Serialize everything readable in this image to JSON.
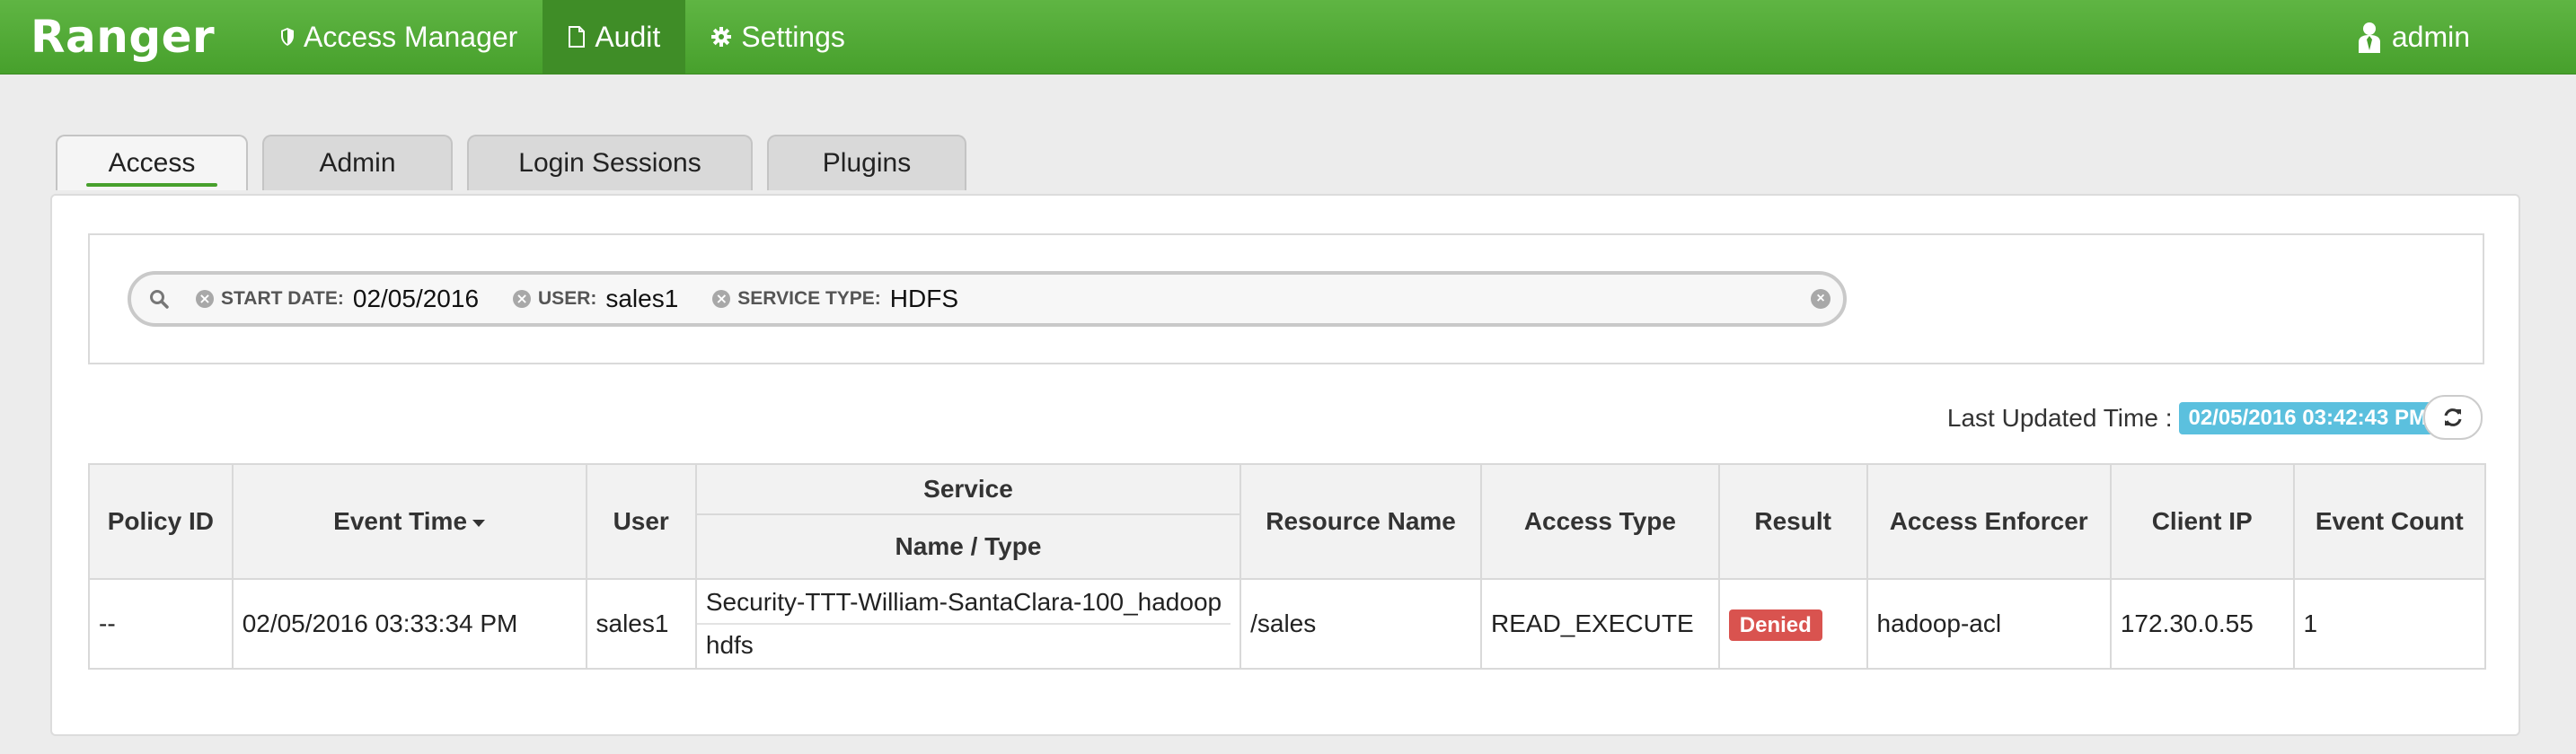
{
  "navbar": {
    "brand": "Ranger",
    "items": [
      {
        "label": "Access Manager",
        "icon": "shield-icon"
      },
      {
        "label": "Audit",
        "icon": "file-icon"
      },
      {
        "label": "Settings",
        "icon": "gear-icon"
      }
    ],
    "user": {
      "label": "admin",
      "icon": "user-icon"
    }
  },
  "tabs": [
    {
      "label": "Access"
    },
    {
      "label": "Admin"
    },
    {
      "label": "Login Sessions"
    },
    {
      "label": "Plugins"
    }
  ],
  "search": {
    "facets": [
      {
        "label": "START DATE:",
        "value": "02/05/2016"
      },
      {
        "label": "USER:",
        "value": "sales1"
      },
      {
        "label": "SERVICE TYPE:",
        "value": "HDFS"
      }
    ]
  },
  "last_updated": {
    "label": "Last Updated Time :",
    "value": "02/05/2016 03:42:43 PM"
  },
  "table": {
    "group_header": "Service",
    "headers": {
      "policy_id": "Policy ID",
      "event_time": "Event Time",
      "user": "User",
      "service_name_type": "Name / Type",
      "resource_name": "Resource Name",
      "access_type": "Access Type",
      "result": "Result",
      "access_enforcer": "Access Enforcer",
      "client_ip": "Client IP",
      "event_count": "Event Count"
    },
    "rows": [
      {
        "policy_id": "--",
        "event_time": "02/05/2016 03:33:34 PM",
        "user": "sales1",
        "service_name": "Security-TTT-William-SantaClara-100_hadoop",
        "service_type": "hdfs",
        "resource_name": "/sales",
        "access_type": "READ_EXECUTE",
        "result": "Denied",
        "access_enforcer": "hadoop-acl",
        "client_ip": "172.30.0.55",
        "event_count": "1"
      }
    ]
  },
  "colors": {
    "navbar_green": "#47a02c",
    "active_nav": "#3f8d27",
    "badge_info": "#5bc0de",
    "badge_denied": "#d9534f"
  }
}
